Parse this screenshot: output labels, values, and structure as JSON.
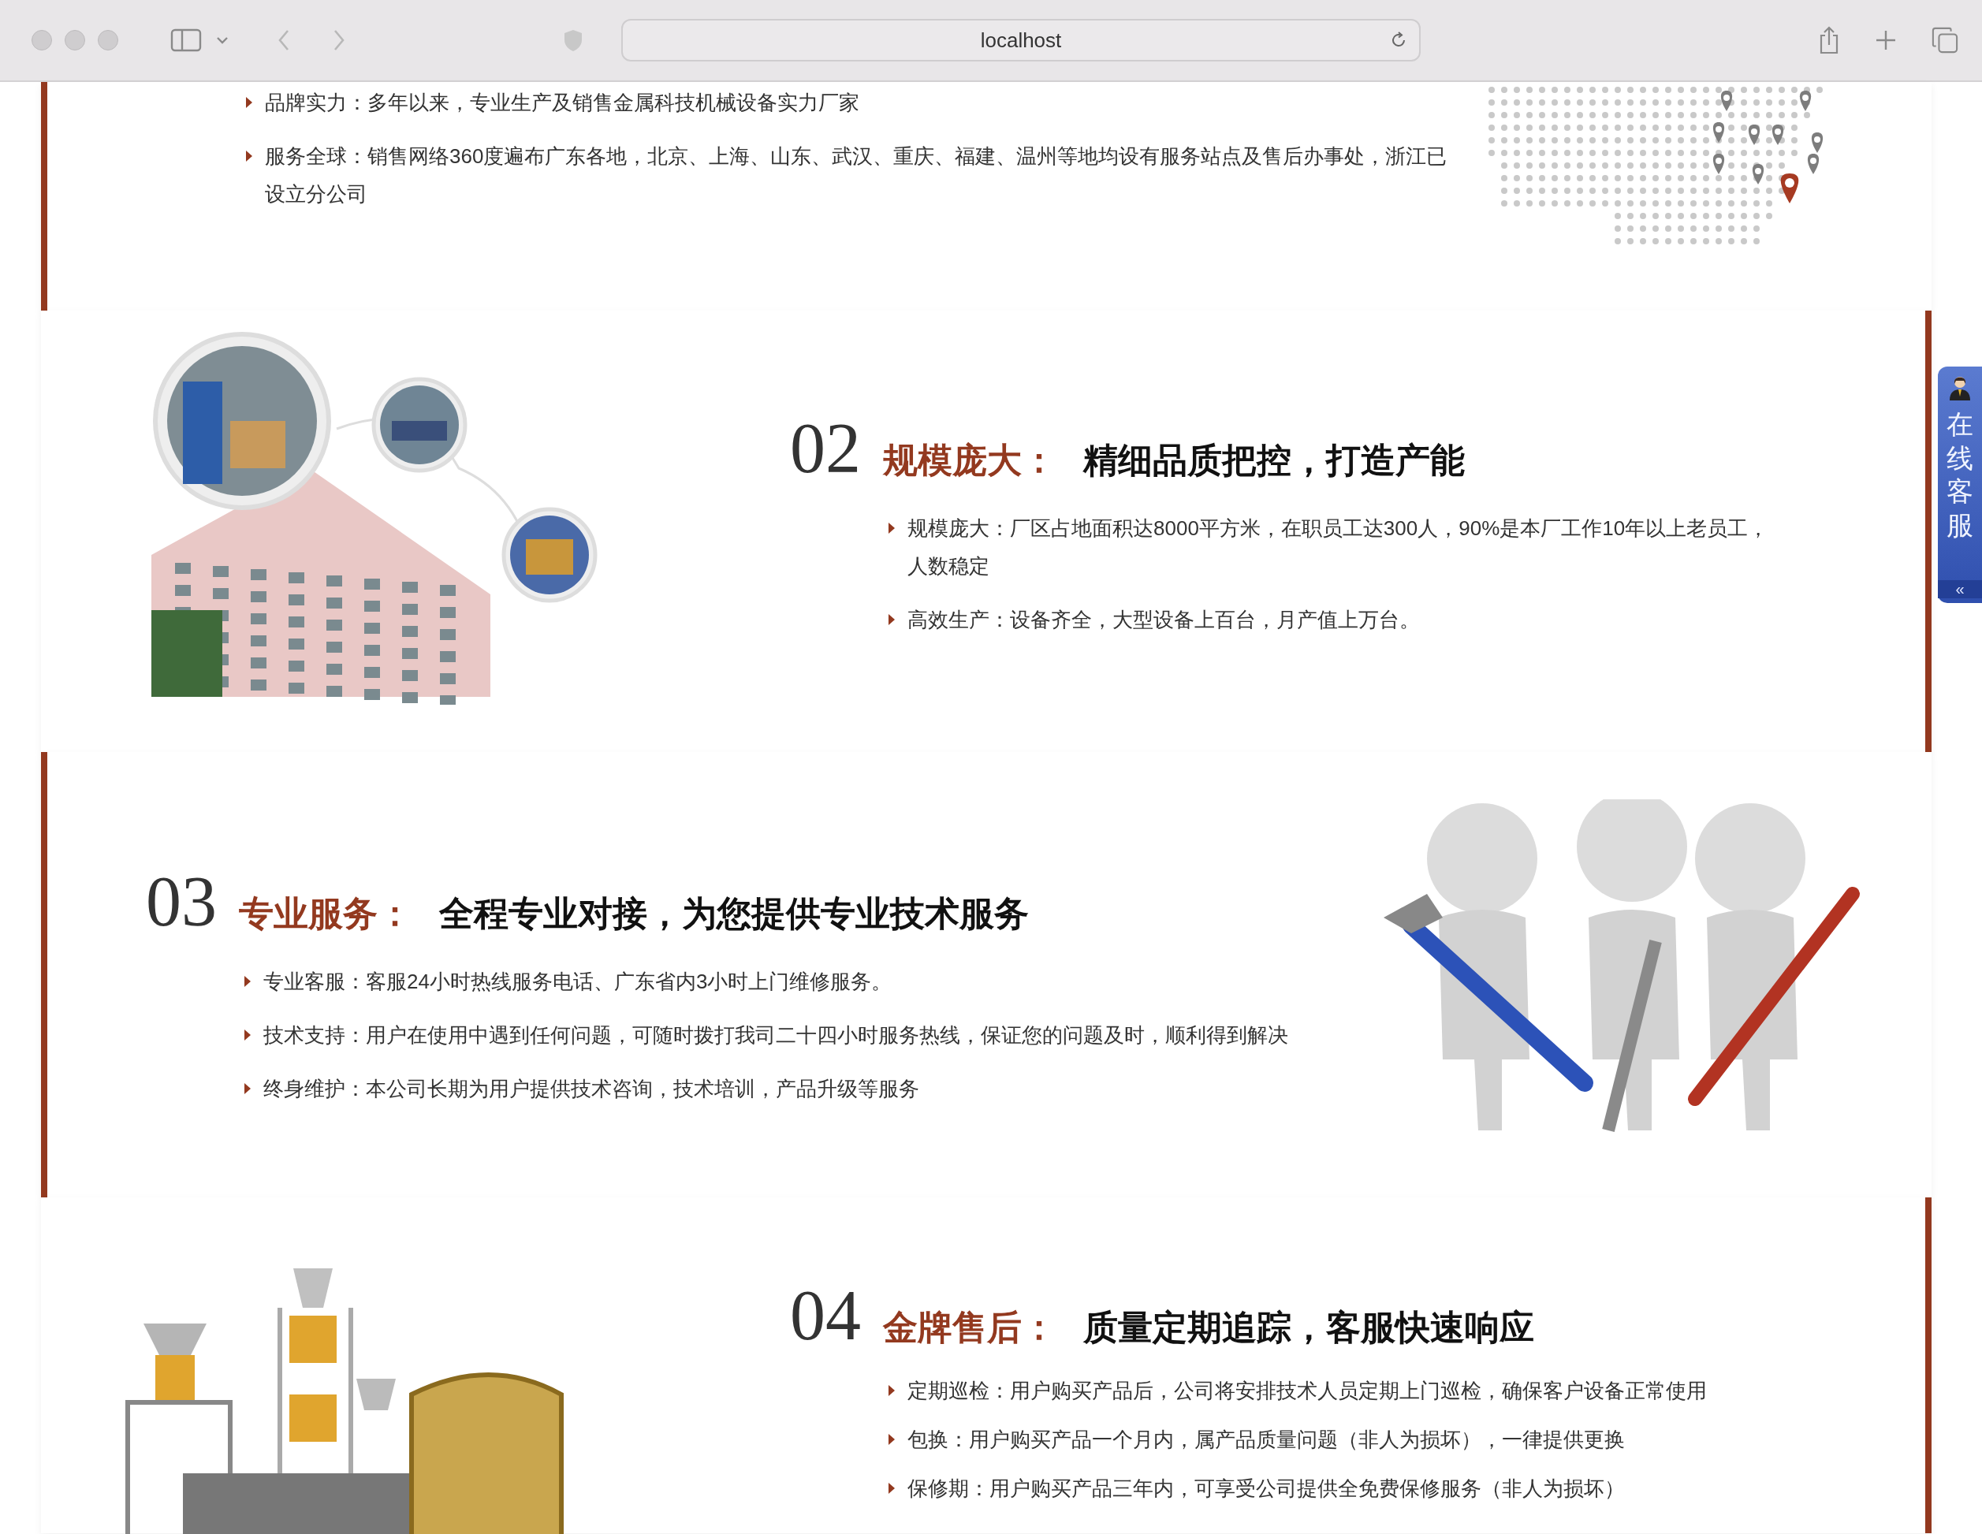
{
  "browser": {
    "address": "localhost"
  },
  "sections": [
    {
      "bullets": [
        "品牌实力：多年以来，专业生产及销售金属科技机械设备实力厂家",
        "服务全球：销售网络360度遍布广东各地，北京、上海、山东、武汉、重庆、福建、温州等地均设有服务站点及售后办事处，浙江已设立分公司"
      ]
    },
    {
      "number": "02",
      "category": "规模庞大：",
      "headline": "精细品质把控，打造产能",
      "bullets": [
        "规模庞大：厂区占地面积达8000平方米，在职员工达300人，90%是本厂工作10年以上老员工，人数稳定",
        "高效生产：设备齐全，大型设备上百台，月产值上万台。"
      ]
    },
    {
      "number": "03",
      "category": "专业服务：",
      "headline": "全程专业对接，为您提供专业技术服务",
      "bullets": [
        "专业客服：客服24小时热线服务电话、广东省内3小时上门维修服务。",
        "技术支持：用户在使用中遇到任何问题，可随时拨打我司二十四小时服务热线，保证您的问题及时，顺利得到解决",
        "终身维护：本公司长期为用户提供技术咨询，技术培训，产品升级等服务"
      ]
    },
    {
      "number": "04",
      "category": "金牌售后：",
      "headline": "质量定期追踪，客服快速响应",
      "bullets": [
        "定期巡检：用户购买产品后，公司将安排技术人员定期上门巡检，确保客户设备正常使用",
        "包换：用户购买产品一个月内，属产品质量问题（非人为损坏），一律提供更换",
        "保修期：用户购买产品三年内，可享受公司提供全免费保修服务（非人为损坏）"
      ]
    }
  ],
  "chat_widget": {
    "label": "在线客服",
    "collapse": "«"
  }
}
